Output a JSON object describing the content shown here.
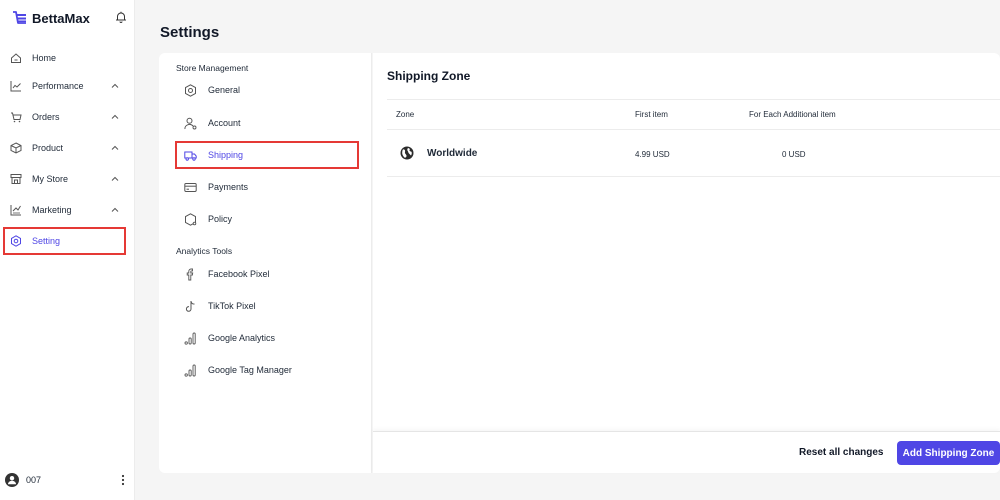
{
  "app": {
    "name": "BettaMax"
  },
  "sidebar": {
    "items": [
      {
        "label": "Home",
        "icon": "home-icon"
      },
      {
        "label": "Performance",
        "icon": "chart-icon"
      },
      {
        "label": "Orders",
        "icon": "cart-icon"
      },
      {
        "label": "Product",
        "icon": "box-icon"
      },
      {
        "label": "My Store",
        "icon": "store-icon"
      },
      {
        "label": "Marketing",
        "icon": "marketing-icon"
      },
      {
        "label": "Setting",
        "icon": "gear-icon",
        "active": true
      }
    ],
    "user": {
      "name": "007"
    }
  },
  "page": {
    "title": "Settings"
  },
  "settings_menu": {
    "store_section": "Store Management",
    "store_items": [
      {
        "label": "General",
        "icon": "gear-icon"
      },
      {
        "label": "Account",
        "icon": "user-icon"
      },
      {
        "label": "Shipping",
        "icon": "truck-icon",
        "active": true
      },
      {
        "label": "Payments",
        "icon": "card-icon"
      },
      {
        "label": "Policy",
        "icon": "shield-icon"
      }
    ],
    "analytics_section": "Analytics Tools",
    "analytics_items": [
      {
        "label": "Facebook Pixel",
        "icon": "facebook-icon"
      },
      {
        "label": "TikTok Pixel",
        "icon": "tiktok-icon"
      },
      {
        "label": "Google Analytics",
        "icon": "analytics-icon"
      },
      {
        "label": "Google Tag Manager",
        "icon": "analytics-icon"
      }
    ]
  },
  "shipping": {
    "title": "Shipping Zone",
    "columns": {
      "zone": "Zone",
      "first_item": "First item",
      "additional": "For Each Additional item"
    },
    "rows": [
      {
        "zone": "Worldwide",
        "first_item": "4.99 USD",
        "additional": "0 USD"
      }
    ]
  },
  "actions": {
    "reset": "Reset all changes",
    "add": "Add Shipping Zone"
  },
  "colors": {
    "accent": "#4f46e5",
    "highlight": "#e53935"
  }
}
